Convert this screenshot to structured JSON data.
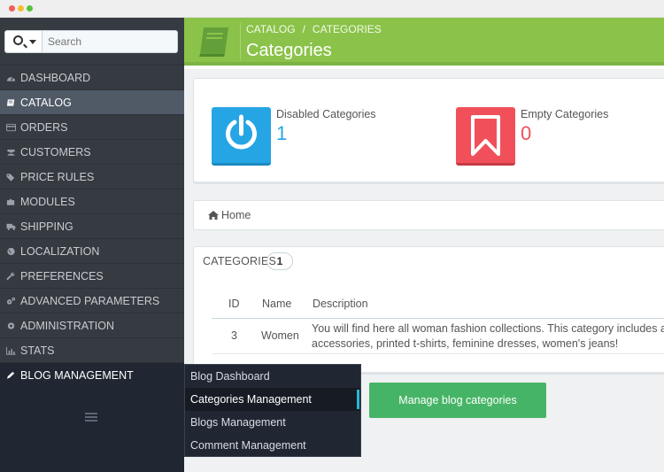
{
  "sidebar": {
    "search": {
      "placeholder": "Search"
    },
    "items": [
      {
        "label": "DASHBOARD",
        "icon": "dashboard-icon"
      },
      {
        "label": "CATALOG",
        "icon": "book-icon",
        "active": true
      },
      {
        "label": "ORDERS",
        "icon": "credit-card-icon"
      },
      {
        "label": "CUSTOMERS",
        "icon": "users-icon"
      },
      {
        "label": "PRICE RULES",
        "icon": "tags-icon"
      },
      {
        "label": "MODULES",
        "icon": "puzzle-icon"
      },
      {
        "label": "SHIPPING",
        "icon": "truck-icon"
      },
      {
        "label": "LOCALIZATION",
        "icon": "globe-icon"
      },
      {
        "label": "PREFERENCES",
        "icon": "wrench-icon"
      },
      {
        "label": "ADVANCED PARAMETERS",
        "icon": "gears-icon"
      },
      {
        "label": "ADMINISTRATION",
        "icon": "gear-icon"
      },
      {
        "label": "STATS",
        "icon": "bar-chart-icon"
      },
      {
        "label": "BLOG MANAGEMENT",
        "icon": "pencil-icon"
      }
    ]
  },
  "header": {
    "breadcrumb": [
      "CATALOG",
      "CATEGORIES"
    ],
    "breadcrumb_sep": "/",
    "title": "Categories",
    "accent": "#8bc34a"
  },
  "kpis": [
    {
      "label": "Disabled Categories",
      "value": "1",
      "icon": "power-icon",
      "color": "#26a5e4"
    },
    {
      "label": "Empty Categories",
      "value": "0",
      "icon": "bookmark-icon",
      "color": "#f1505a"
    }
  ],
  "breadcrumb_bar": {
    "home": "Home"
  },
  "categories": {
    "title": "CATEGORIES",
    "count": "1",
    "columns": [
      "ID",
      "Name",
      "Description"
    ],
    "rows": [
      {
        "id": "3",
        "name": "Women",
        "description_line1": "You will find here all woman fashion collections. This category includes a",
        "description_line2": "accessories, printed t-shirts, feminine dresses, women's jeans!"
      }
    ]
  },
  "submenu": {
    "items": [
      "Blog Dashboard",
      "Categories Management",
      "Blogs Management",
      "Comment Management"
    ],
    "active_index": 1
  },
  "tooltip": {
    "text": "Manage blog categories",
    "color": "#46b466"
  }
}
